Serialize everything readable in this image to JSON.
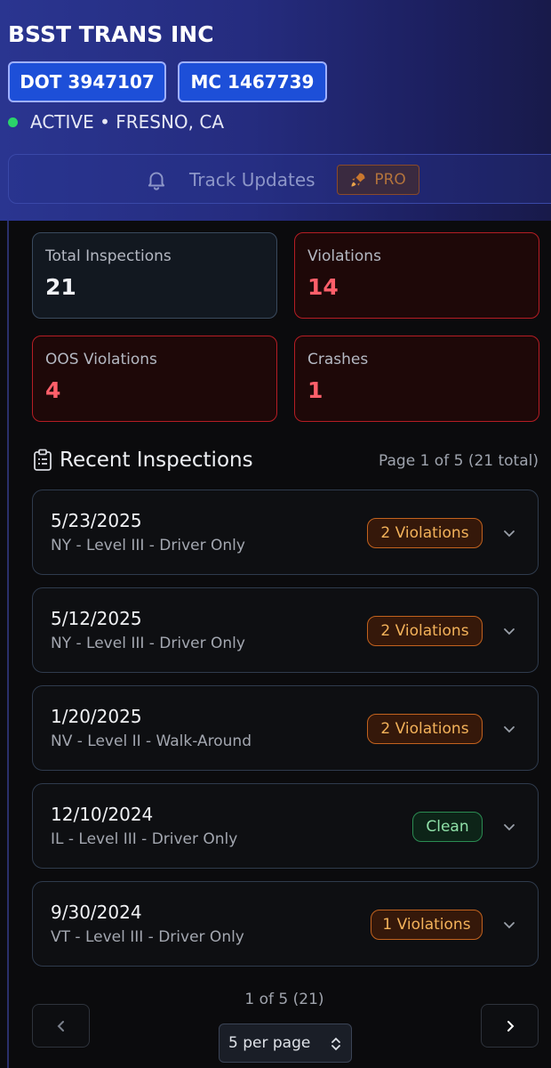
{
  "header": {
    "company_name": "BSST TRANS INC",
    "dot_label": "DOT 3947107",
    "mc_label": "MC 1467739",
    "status_text": "ACTIVE • FRESNO, CA",
    "status_color": "#2bd46a",
    "track_label": "Track Updates",
    "pro_label": "PRO"
  },
  "stats": [
    {
      "label": "Total Inspections",
      "value": "21",
      "tone": "neutral"
    },
    {
      "label": "Violations",
      "value": "14",
      "tone": "danger"
    },
    {
      "label": "OOS Violations",
      "value": "4",
      "tone": "danger"
    },
    {
      "label": "Crashes",
      "value": "1",
      "tone": "danger"
    }
  ],
  "recent": {
    "title": "Recent Inspections",
    "page_info": "Page 1 of 5 (21 total)",
    "items": [
      {
        "date": "5/23/2025",
        "desc": "NY - Level III - Driver Only",
        "badge": "2 Violations",
        "tone": "warn"
      },
      {
        "date": "5/12/2025",
        "desc": "NY - Level III - Driver Only",
        "badge": "2 Violations",
        "tone": "warn"
      },
      {
        "date": "1/20/2025",
        "desc": "NV - Level II - Walk-Around",
        "badge": "2 Violations",
        "tone": "warn"
      },
      {
        "date": "12/10/2024",
        "desc": "IL - Level III - Driver Only",
        "badge": "Clean",
        "tone": "ok"
      },
      {
        "date": "9/30/2024",
        "desc": "VT - Level III - Driver Only",
        "badge": "1 Violations",
        "tone": "warn"
      }
    ]
  },
  "pagination": {
    "count_text": "1 of 5 (21)",
    "per_page": "5 per page"
  }
}
